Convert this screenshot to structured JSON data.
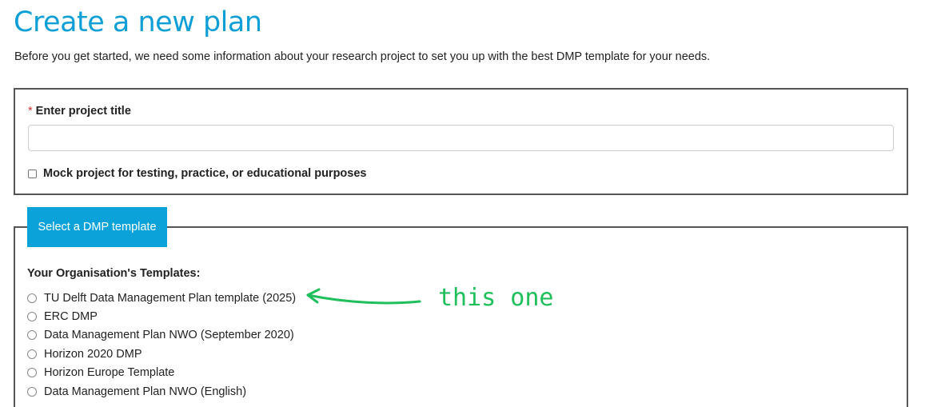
{
  "page": {
    "title": "Create a new plan",
    "intro": "Before you get started, we need some information about your research project to set you up with the best DMP template for your needs."
  },
  "project": {
    "required_mark": "*",
    "title_label": "Enter project title",
    "title_value": "",
    "mock_label": "Mock project for testing, practice, or educational purposes",
    "mock_checked": false
  },
  "template_section": {
    "tab_label": "Select a DMP template",
    "heading": "Your Organisation's Templates:",
    "templates": [
      {
        "label": "TU Delft Data Management Plan template (2025)"
      },
      {
        "label": "ERC DMP"
      },
      {
        "label": "Data Management Plan NWO (September 2020)"
      },
      {
        "label": "Horizon 2020 DMP"
      },
      {
        "label": "Horizon Europe Template"
      },
      {
        "label": "Data Management Plan NWO (English)"
      }
    ]
  },
  "annotation": {
    "text": "this one",
    "color": "#1fbf5b"
  },
  "colors": {
    "accent": "#0aa2d8",
    "title": "#0d9fd6",
    "required": "#d9332e"
  }
}
